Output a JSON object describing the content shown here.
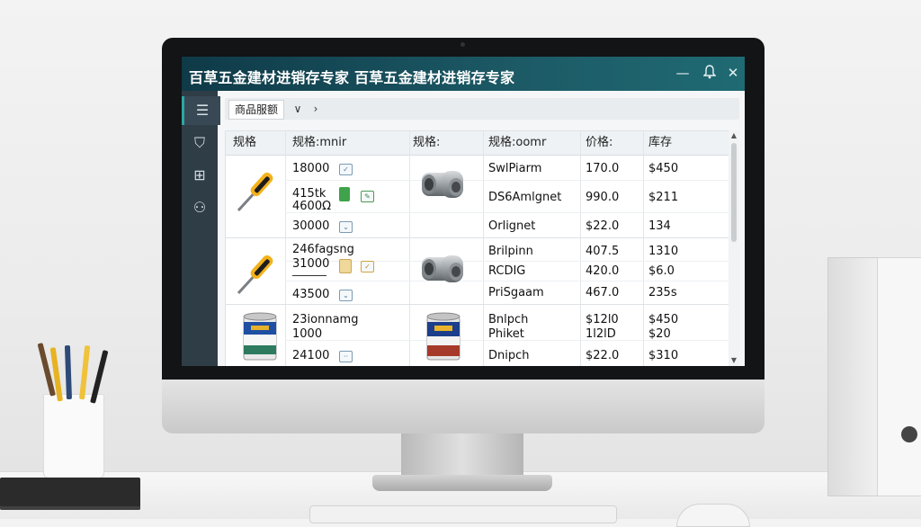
{
  "app": {
    "title": "百草五金建材进销存专家  百草五金建材进销存专家"
  },
  "window_controls": {
    "minimize": "—",
    "bell": "🔔",
    "close": "✕"
  },
  "sidebar": {
    "items": [
      {
        "icon": "menu-icon",
        "glyph": "☰"
      },
      {
        "icon": "cone-icon",
        "glyph": "⛉"
      },
      {
        "icon": "grid-icon",
        "glyph": "⊞"
      },
      {
        "icon": "people-icon",
        "glyph": "⚇"
      }
    ]
  },
  "toolbar": {
    "tab_label": "商品服额",
    "chevron_down": "∨",
    "chevron_right": "›"
  },
  "table": {
    "headers": [
      "规格",
      "规格:mnir",
      "规格:",
      "规格:oomr",
      "价格:",
      "库存"
    ],
    "groups": [
      {
        "image": "screwdriver",
        "rows": [
          {
            "spec": "18000",
            "name": "SwlPiarm",
            "price": "170.0",
            "stock": "$450"
          },
          {
            "spec": "415tk\n4600Ω",
            "name": "DS6Amlgnet",
            "price": "990.0",
            "stock": "$211"
          },
          {
            "spec": "30000",
            "name": "Orlignet",
            "price": "$22.0",
            "stock": "134"
          }
        ]
      },
      {
        "image": "screwdriver",
        "rows": [
          {
            "spec": "246fagsng\n31000",
            "name": "Brilpinn",
            "price": "407.5",
            "stock": "1310"
          },
          {
            "spec": "",
            "name": "RCDIG",
            "price": "420.0",
            "stock": "$6.0"
          },
          {
            "spec": "43500",
            "name": "PriSgaam",
            "price": "467.0",
            "stock": "235s"
          }
        ]
      },
      {
        "image": "paint-can",
        "rows": [
          {
            "spec": "23ionnamg\n1000",
            "name": "Bnlpch\nPhiket",
            "price": "$12l0\n1l2lD",
            "stock": "$450\n$20"
          },
          {
            "spec": "24100",
            "name": "Dnipch",
            "price": "$22.0",
            "stock": "$310"
          }
        ]
      }
    ]
  }
}
